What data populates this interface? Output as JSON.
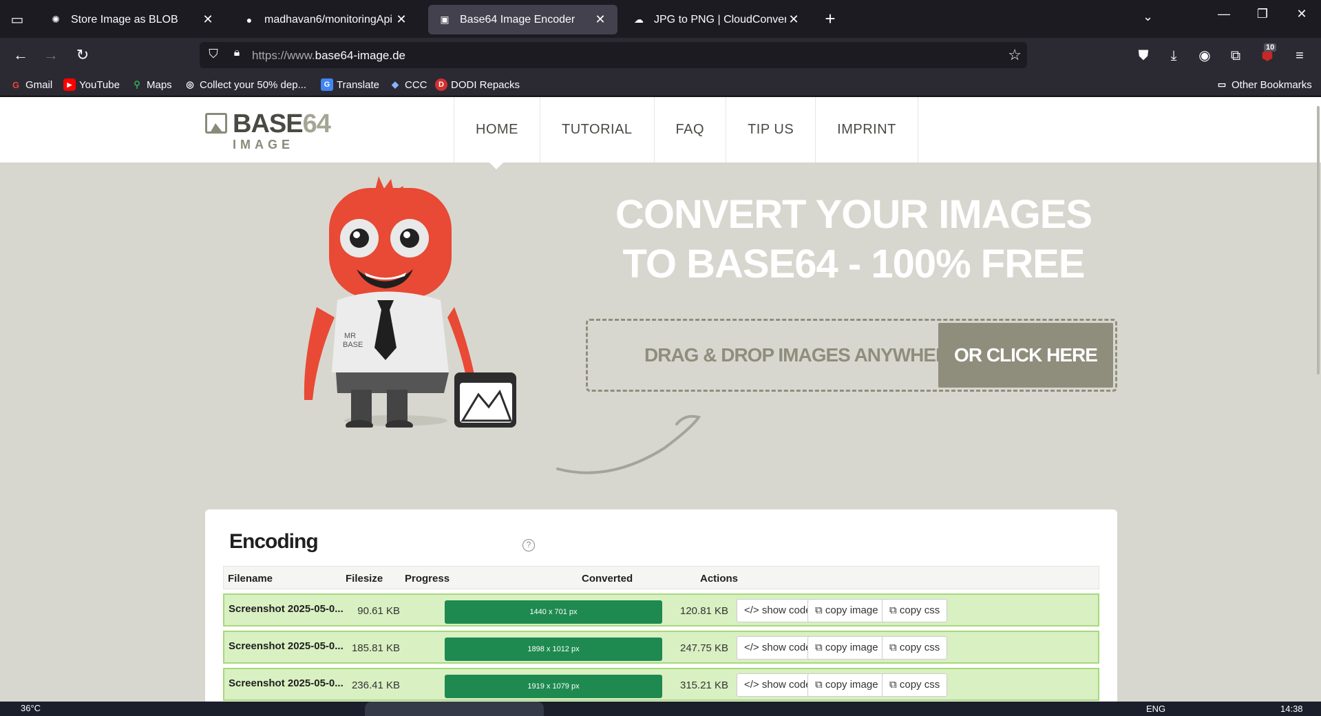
{
  "browser": {
    "tabs": [
      {
        "title": "Store Image as BLOB",
        "favicon": "chatgpt-icon",
        "active": false
      },
      {
        "title": "madhavan6/monitoringApi",
        "favicon": "github-icon",
        "active": false
      },
      {
        "title": "Base64 Image Encoder",
        "favicon": "image-icon",
        "active": true
      },
      {
        "title": "JPG to PNG | CloudConvert",
        "favicon": "cloud-icon",
        "active": false
      }
    ],
    "url_protocol": "https://www.",
    "url_domain": "base64-image.de",
    "extension_badge": "10",
    "bookmarks": [
      {
        "label": "Gmail",
        "icon": "G"
      },
      {
        "label": "YouTube",
        "icon": "▶"
      },
      {
        "label": "Maps",
        "icon": "⚲"
      },
      {
        "label": "Collect your 50% dep...",
        "icon": "◎"
      },
      {
        "label": "Translate",
        "icon": "G"
      },
      {
        "label": "CCC",
        "icon": "◆"
      },
      {
        "label": "DODI Repacks",
        "icon": "D"
      }
    ],
    "other_bookmarks": "Other Bookmarks"
  },
  "site": {
    "logo_main": "BASE",
    "logo_accent": "64",
    "logo_sub": "IMAGE",
    "nav": [
      "HOME",
      "TUTORIAL",
      "FAQ",
      "TIP US",
      "IMPRINT"
    ],
    "hero_line1": "CONVERT YOUR IMAGES",
    "hero_line2": "TO BASE64 - 100% FREE",
    "dropzone_text": "DRAG & DROP IMAGES ANYWHERE",
    "dropzone_button": "OR CLICK HERE",
    "mascot_label": "MR BASE"
  },
  "encoding": {
    "title": "Encoding",
    "help": "?",
    "columns": {
      "filename": "Filename",
      "filesize": "Filesize",
      "progress": "Progress",
      "converted": "Converted",
      "actions": "Actions"
    },
    "rows": [
      {
        "filename": "Screenshot 2025-05-0...",
        "filesize": "90.61 KB",
        "progress_label": "1440 x 701 px",
        "converted": "120.81 KB"
      },
      {
        "filename": "Screenshot 2025-05-0...",
        "filesize": "185.81 KB",
        "progress_label": "1898 x 1012 px",
        "converted": "247.75 KB"
      },
      {
        "filename": "Screenshot 2025-05-0...",
        "filesize": "236.41 KB",
        "progress_label": "1919 x 1079 px",
        "converted": "315.21 KB"
      }
    ],
    "actions": {
      "show_code": "</> show code",
      "copy_image": "⧉ copy image",
      "copy_css": "⧉ copy css"
    }
  },
  "taskbar": {
    "weather": "36°C",
    "language": "ENG",
    "time": "14:38"
  },
  "colors": {
    "accent": "#8f8e7d",
    "progress": "#1e8a50",
    "row_bg": "#d9f0c2",
    "page_bg": "#d8d7cf"
  }
}
